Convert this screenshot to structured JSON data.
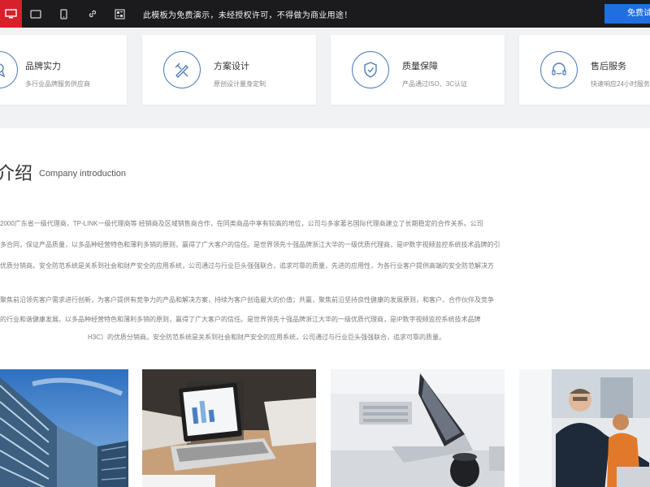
{
  "topbar": {
    "notice": "此模板为免费演示，未经授权许可，不得做为商业用途！",
    "cta_label": "免费试用"
  },
  "features": [
    {
      "title": "品牌实力",
      "subtitle": "多行业品牌服务供应商"
    },
    {
      "title": "方案设计",
      "subtitle": "原创设计量身定制"
    },
    {
      "title": "质量保障",
      "subtitle": "产品通过ISO、3C认证"
    },
    {
      "title": "售后服务",
      "subtitle": "快速响应24小时服务"
    }
  ],
  "intro": {
    "title": "介绍",
    "subtitle": "Company introduction",
    "paragraphs": [
      "2000广东省一级代理商，TP-LINK一级代理商等 经销商及区域销售商合作，在同类商品中享有较高的地位，公司与多家著名国际代理商建立了长期稳定的合作关系。公司",
      "多合同，保证产品质量，以多品种经营特色和薄利多销的原则，赢得了广大客户的信任。是世界领先十强品牌浙江大华的一级优质代理商，是IP数字视频监控系统技术品牌的引",
      "优质分销商。安全防范系统是关系到社会和财产安全的应用系统，公司通过与行业巨头强强联合，追求可靠的质量，先进的应用性，为各行业客户提供高端的安全防范解决方",
      "聚焦前沿领先客户需求进行创新，为客户提供有竞争力的产品和解决方案，持续为客户创造最大的价值；共赢，聚焦前沿坚持良性健康的发展原则，和客户、合作伙伴及竞争",
      "的行业和谐健康发展。以多品种经营特色和薄利多销的原则，赢得了广大客户的信任。是世界领先十强品牌浙江大华的一级优质代理商，是IP数字视频监控系统技术品牌",
      "H3C）的优质分销商。安全防范系统是关系到社会和财产安全的应用系统，公司通过与行业巨头强强联合，追求可靠的质量。"
    ]
  }
}
